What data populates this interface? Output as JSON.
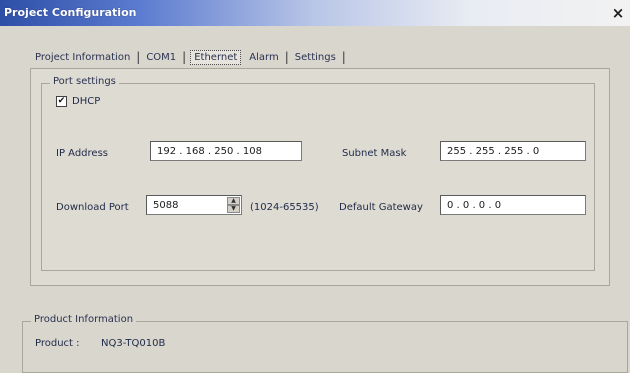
{
  "window": {
    "title": "Project Configuration",
    "close_glyph": "×"
  },
  "tabs": [
    {
      "label": "Project Information"
    },
    {
      "label": "COM1"
    },
    {
      "label": "Ethernet",
      "active": true
    },
    {
      "label": "Alarm"
    },
    {
      "label": "Settings"
    }
  ],
  "port_settings": {
    "legend": "Port settings",
    "dhcp": {
      "label": "DHCP",
      "checked": true,
      "check_glyph": "✔"
    },
    "ip_address": {
      "label": "IP Address",
      "value": "192 . 168 . 250 . 108"
    },
    "subnet_mask": {
      "label": "Subnet Mask",
      "value": "255 . 255 . 255 . 0"
    },
    "download_port": {
      "label": "Download Port",
      "value": "5088",
      "range": "(1024-65535)"
    },
    "default_gateway": {
      "label": "Default Gateway",
      "value": "0 . 0 . 0 . 0"
    }
  },
  "product_information": {
    "legend": "Product Information",
    "product_label": "Product :",
    "product_value": "NQ3-TQ010B"
  }
}
